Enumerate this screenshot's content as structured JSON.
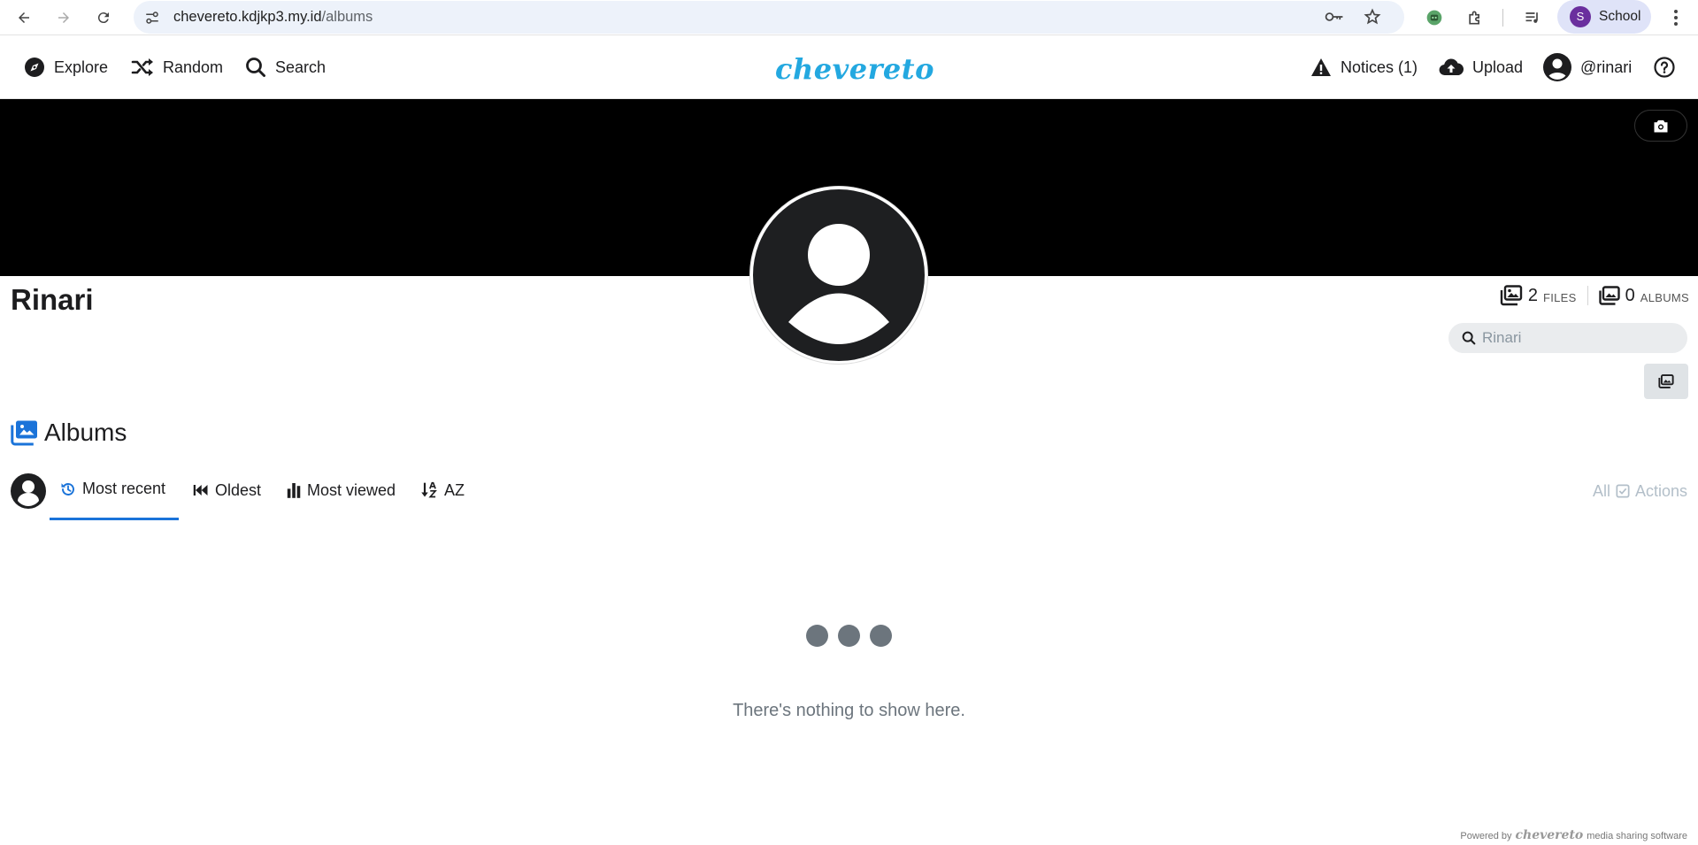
{
  "browser": {
    "url_host": "chevereto.kdjkp3.my.id",
    "url_path": "/albums",
    "profile_initial": "S",
    "profile_label": "School"
  },
  "nav": {
    "explore": "Explore",
    "random": "Random",
    "search": "Search",
    "logo": "chevereto",
    "notices": "Notices (1)",
    "upload": "Upload",
    "user": "@rinari"
  },
  "profile": {
    "name": "Rinari",
    "files_count": "2",
    "files_label": "FILES",
    "albums_count": "0",
    "albums_label": "ALBUMS",
    "search_placeholder": "Rinari"
  },
  "section": {
    "title": "Albums"
  },
  "tabs": [
    {
      "label": "Most recent",
      "icon": "history-icon",
      "active": true
    },
    {
      "label": "Oldest",
      "icon": "backward-icon",
      "active": false
    },
    {
      "label": "Most viewed",
      "icon": "bar-chart-icon",
      "active": false
    },
    {
      "label": "AZ",
      "icon": "sort-az-icon",
      "active": false
    }
  ],
  "list_actions": {
    "all": "All",
    "actions": "Actions"
  },
  "empty_message": "There's nothing to show here.",
  "footer": {
    "prefix": "Powered by",
    "brand": "chevereto",
    "suffix": "media sharing software"
  },
  "colors": {
    "accent": "#1a73d9",
    "logo": "#23a8e0",
    "cover": "#000000"
  }
}
